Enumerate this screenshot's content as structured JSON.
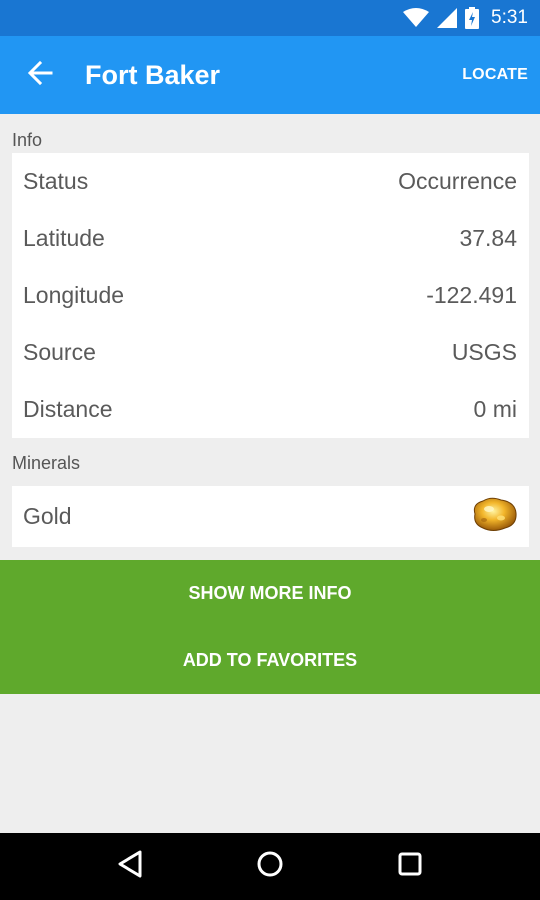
{
  "status_bar": {
    "time": "5:31"
  },
  "app_bar": {
    "title": "Fort Baker",
    "locate_label": "LOCATE"
  },
  "info": {
    "section_label": "Info",
    "rows": [
      {
        "label": "Status",
        "value": "Occurrence"
      },
      {
        "label": "Latitude",
        "value": "37.84"
      },
      {
        "label": "Longitude",
        "value": "-122.491"
      },
      {
        "label": "Source",
        "value": "USGS"
      },
      {
        "label": "Distance",
        "value": "0 mi"
      }
    ]
  },
  "minerals": {
    "section_label": "Minerals",
    "items": [
      {
        "name": "Gold",
        "icon": "gold-nugget-icon"
      }
    ]
  },
  "actions": {
    "show_more_label": "SHOW MORE INFO",
    "favorites_label": "ADD TO FAVORITES"
  },
  "colors": {
    "status_bar": "#1976d2",
    "app_bar": "#2196f3",
    "action_panel": "#5fa92c"
  }
}
